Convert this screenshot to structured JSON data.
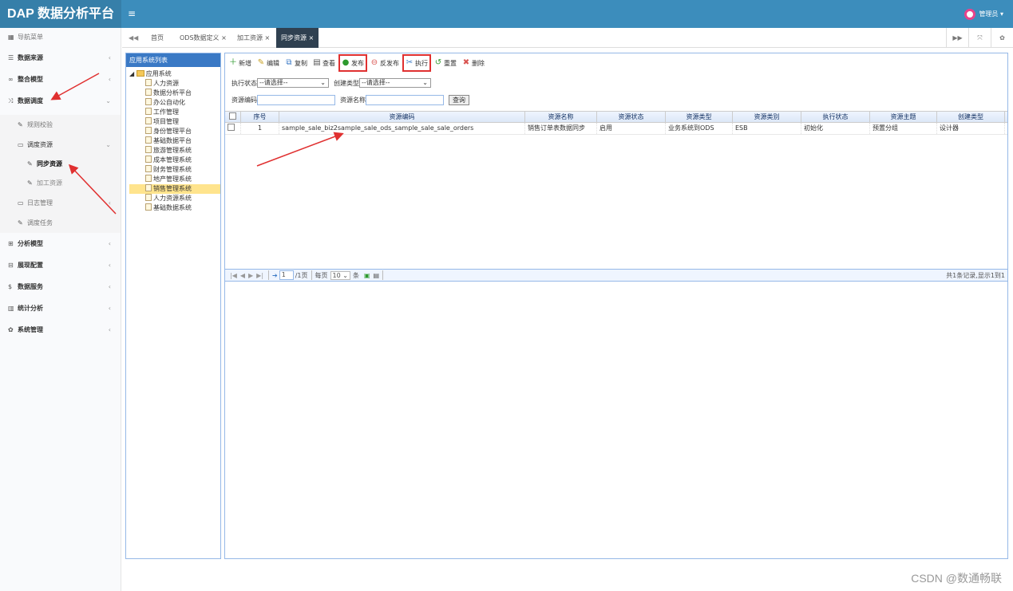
{
  "header": {
    "brand": "DAP 数据分析平台",
    "toggle_icon": "≡",
    "user_label": "管理员 ▾"
  },
  "sidebar": {
    "title": "导航菜单",
    "items": [
      {
        "label": "数据来源",
        "icon": "database-icon"
      },
      {
        "label": "整合模型",
        "icon": "link-icon"
      },
      {
        "label": "数据调度",
        "icon": "random-icon"
      },
      {
        "label": "分析模型",
        "icon": "sitemap-icon"
      },
      {
        "label": "展现配置",
        "icon": "columns-icon"
      },
      {
        "label": "数据服务",
        "icon": "dollar-icon"
      },
      {
        "label": "统计分析",
        "icon": "bar-chart-icon"
      },
      {
        "label": "系统管理",
        "icon": "gear-icon"
      }
    ],
    "schedule_sub": {
      "rule_check": "规则校验",
      "schedule_resource": "调度资源",
      "sync_resource": "同步资源",
      "process_resource": "加工资源",
      "log_manage": "日志管理",
      "schedule_task": "调度任务"
    }
  },
  "tabs": {
    "home": "首页",
    "ods": "ODS数据定义 ×",
    "process": "加工资源 ×",
    "sync": "同步资源 ×"
  },
  "tree": {
    "panel_title": "应用系统列表",
    "root": "应用系统",
    "nodes": [
      "人力资源",
      "数据分析平台",
      "办公自动化",
      "工作管理",
      "项目管理",
      "身份管理平台",
      "基础数据平台",
      "旅游管理系统",
      "成本管理系统",
      "财务管理系统",
      "地产管理系统",
      "销售管理系统",
      "人力资源系统",
      "基础数据系统"
    ],
    "selected": "销售管理系统"
  },
  "toolbar": {
    "add": "新增",
    "edit": "编辑",
    "copy": "复制",
    "view": "查看",
    "publish": "发布",
    "unpublish": "反发布",
    "execute": "执行",
    "reset": "重置",
    "delete": "删除"
  },
  "filters": {
    "exec_status_label": "执行状态",
    "exec_status_value": "--请选择--",
    "create_type_label": "创建类型",
    "create_type_value": "--请选择--",
    "code_label": "资源编码",
    "name_label": "资源名称",
    "query_button": "查询"
  },
  "grid": {
    "headers": [
      "序号",
      "资源编码",
      "资源名称",
      "资源状态",
      "资源类型",
      "资源类别",
      "执行状态",
      "资源主题",
      "创建类型"
    ],
    "rows": [
      [
        "1",
        "sample_sale_biz2sample_sale_ods_sample_sale_sale_orders",
        "销售订单表数据同步",
        "启用",
        "业务系统到ODS",
        "ESB",
        "初始化",
        "预置分组",
        "设计器"
      ]
    ]
  },
  "pager": {
    "page": "1",
    "total_pages": "/1页",
    "per_page_label": "每页",
    "per_page": "10",
    "unit": "条",
    "info": "共1条记录,显示1到1"
  },
  "watermark": "CSDN @数通畅联",
  "colors": {
    "header": "#3c8dbc",
    "brand_bg": "#367fa9",
    "annotation": "#e03030",
    "grid_border": "#95b8e7"
  }
}
